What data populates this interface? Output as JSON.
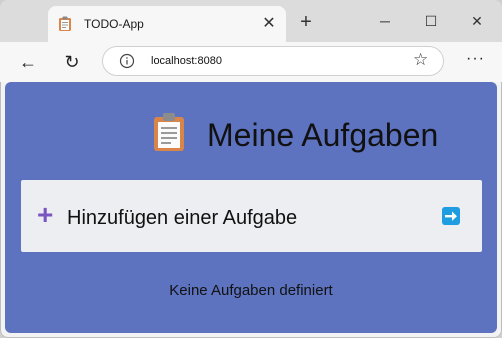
{
  "browser": {
    "tab_title": "TODO-App",
    "tab_close": "✕",
    "new_tab": "+",
    "minimize": "─",
    "maximize": "☐",
    "close": "✕",
    "back": "←",
    "reload": "↻",
    "url": "localhost:8080",
    "favorite": "☆",
    "menu": "···"
  },
  "app": {
    "title": "Meine Aufgaben",
    "add_label": "Hinzufügen einer Aufgabe",
    "add_icon": "+",
    "empty_message": "Keine Aufgaben definiert"
  },
  "colors": {
    "page_background": "#5d73c0",
    "add_icon": "#7a57c0",
    "submit_button": "#1e9ee0"
  }
}
